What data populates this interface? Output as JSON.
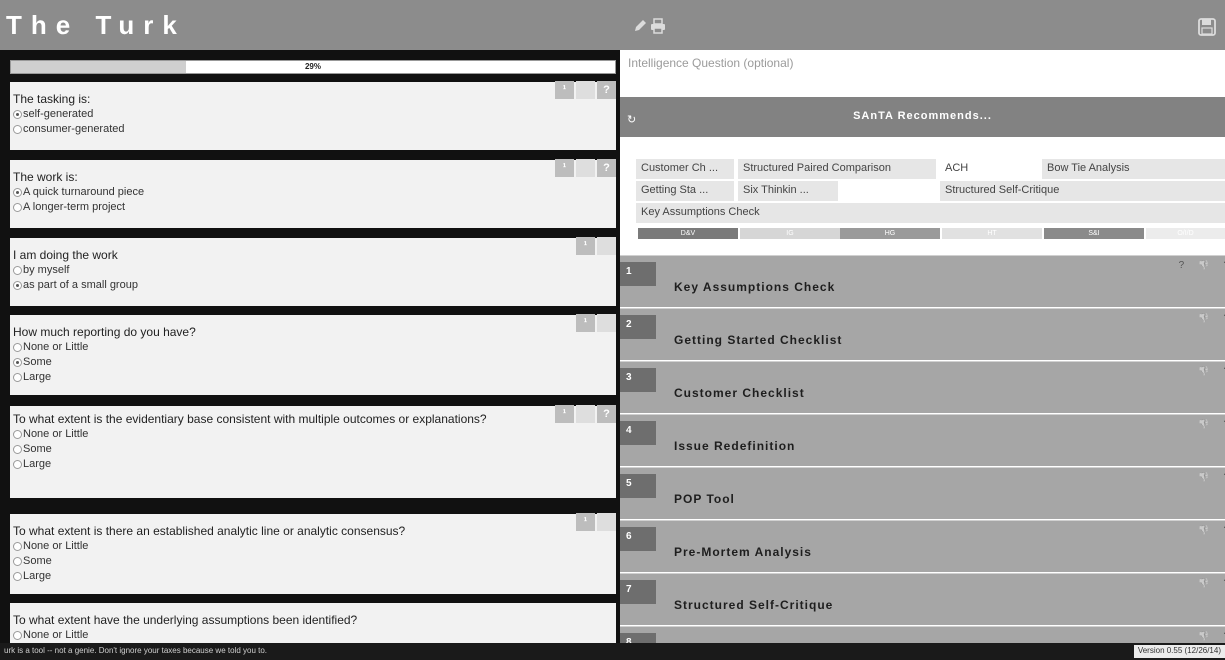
{
  "app": {
    "title": "The Turk"
  },
  "progress": {
    "value": 0.29,
    "label": "29%"
  },
  "questions": [
    {
      "text": "The tasking is:",
      "options": [
        {
          "label": "self-generated",
          "selected": true
        },
        {
          "label": "consumer-generated",
          "selected": false
        }
      ]
    },
    {
      "text": "The work is:",
      "options": [
        {
          "label": "A quick turnaround piece",
          "selected": true
        },
        {
          "label": "A longer-term project",
          "selected": false
        }
      ]
    },
    {
      "text": "I am doing the work",
      "options": [
        {
          "label": "by myself",
          "selected": false
        },
        {
          "label": "as part of a small group",
          "selected": true
        }
      ]
    },
    {
      "text": "How much reporting do you have?",
      "options": [
        {
          "label": "None or Little",
          "selected": false
        },
        {
          "label": "Some",
          "selected": true
        },
        {
          "label": "Large",
          "selected": false
        }
      ]
    },
    {
      "text": "To what extent is the evidentiary base consistent with multiple outcomes or explanations?",
      "options": [
        {
          "label": "None or Little",
          "selected": false
        },
        {
          "label": "Some",
          "selected": false
        },
        {
          "label": "Large",
          "selected": false
        }
      ]
    },
    {
      "text": "To what extent is there an established analytic line or analytic consensus?",
      "options": [
        {
          "label": "None or Little",
          "selected": false
        },
        {
          "label": "Some",
          "selected": false
        },
        {
          "label": "Large",
          "selected": false
        }
      ]
    },
    {
      "text": "To what extent have the underlying assumptions been identified?",
      "options": [
        {
          "label": "None or Little",
          "selected": false
        }
      ]
    }
  ],
  "intelligence_question": {
    "placeholder": "Intelligence Question (optional)"
  },
  "santa": {
    "title": "SAnTA Recommends...",
    "recommendations": [
      "Customer Ch ...",
      "Structured Paired Comparison",
      "ACH",
      "Bow Tie Analysis",
      "Getting Sta ...",
      "Six Thinkin ...",
      "Structured Self-Critique",
      "Key Assumptions Check"
    ],
    "categories": [
      {
        "label": "D&V",
        "color": "#7a7a7a"
      },
      {
        "label": "IG",
        "color": "#d6d6d6"
      },
      {
        "label": "HG",
        "color": "#9a9a9a"
      },
      {
        "label": "HT",
        "color": "#e1e1e1"
      },
      {
        "label": "S&I",
        "color": "#8a8a8a"
      },
      {
        "label": "O/I/D",
        "color": "#ececec"
      }
    ]
  },
  "techniques": [
    {
      "num": "1",
      "name": "Key Assumptions Check",
      "help": "?"
    },
    {
      "num": "2",
      "name": "Getting Started Checklist",
      "help": ""
    },
    {
      "num": "3",
      "name": "Customer Checklist",
      "help": ""
    },
    {
      "num": "4",
      "name": "Issue Redefinition",
      "help": ""
    },
    {
      "num": "5",
      "name": "POP Tool",
      "help": ""
    },
    {
      "num": "6",
      "name": "Pre-Mortem Analysis",
      "help": ""
    },
    {
      "num": "7",
      "name": "Structured Self-Critique",
      "help": ""
    },
    {
      "num": "8",
      "name": "",
      "help": ""
    }
  ],
  "footer": {
    "note": "urk is a tool -- not a genie. Don't ignore your taxes because we told you to.",
    "version": "Version 0.55 (12/26/14)"
  },
  "icons": {
    "edit": "pencil-icon",
    "print": "printer-icon",
    "save": "save-icon",
    "refresh": "refresh-icon",
    "thumb": "thumbs-down-icon",
    "help": "help-icon"
  }
}
